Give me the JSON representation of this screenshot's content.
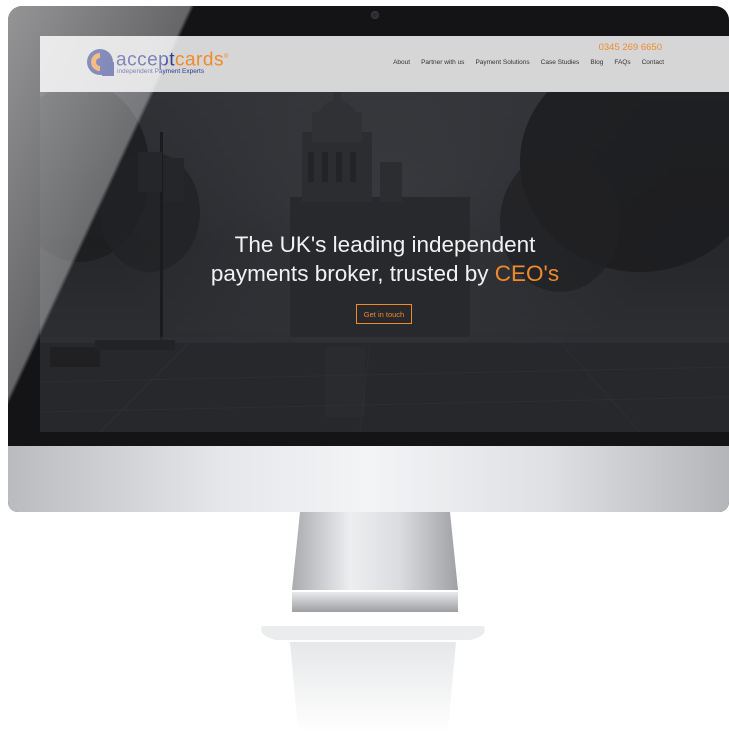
{
  "website": {
    "logo": {
      "word_part1": "accept",
      "word_part2": "cards",
      "trademark": "®",
      "tagline": "independent Payment Experts"
    },
    "phone": "0345 269 6650",
    "nav": [
      "About",
      "Partner with us",
      "Payment Solutions",
      "Case Studies",
      "Blog",
      "FAQs",
      "Contact"
    ],
    "hero": {
      "headline_line1": "The UK's leading independent",
      "headline_line2_prefix": "payments broker, trusted by ",
      "headline_accent": "CEO's",
      "cta_label": "Get in touch"
    }
  },
  "colors": {
    "brand_blue": "#2d3a8c",
    "brand_orange": "#f08a2c",
    "header_bg": "#d6d6d6",
    "monitor_bezel": "#141417"
  },
  "icons": [
    "camera-icon",
    "logo-mark-icon"
  ]
}
